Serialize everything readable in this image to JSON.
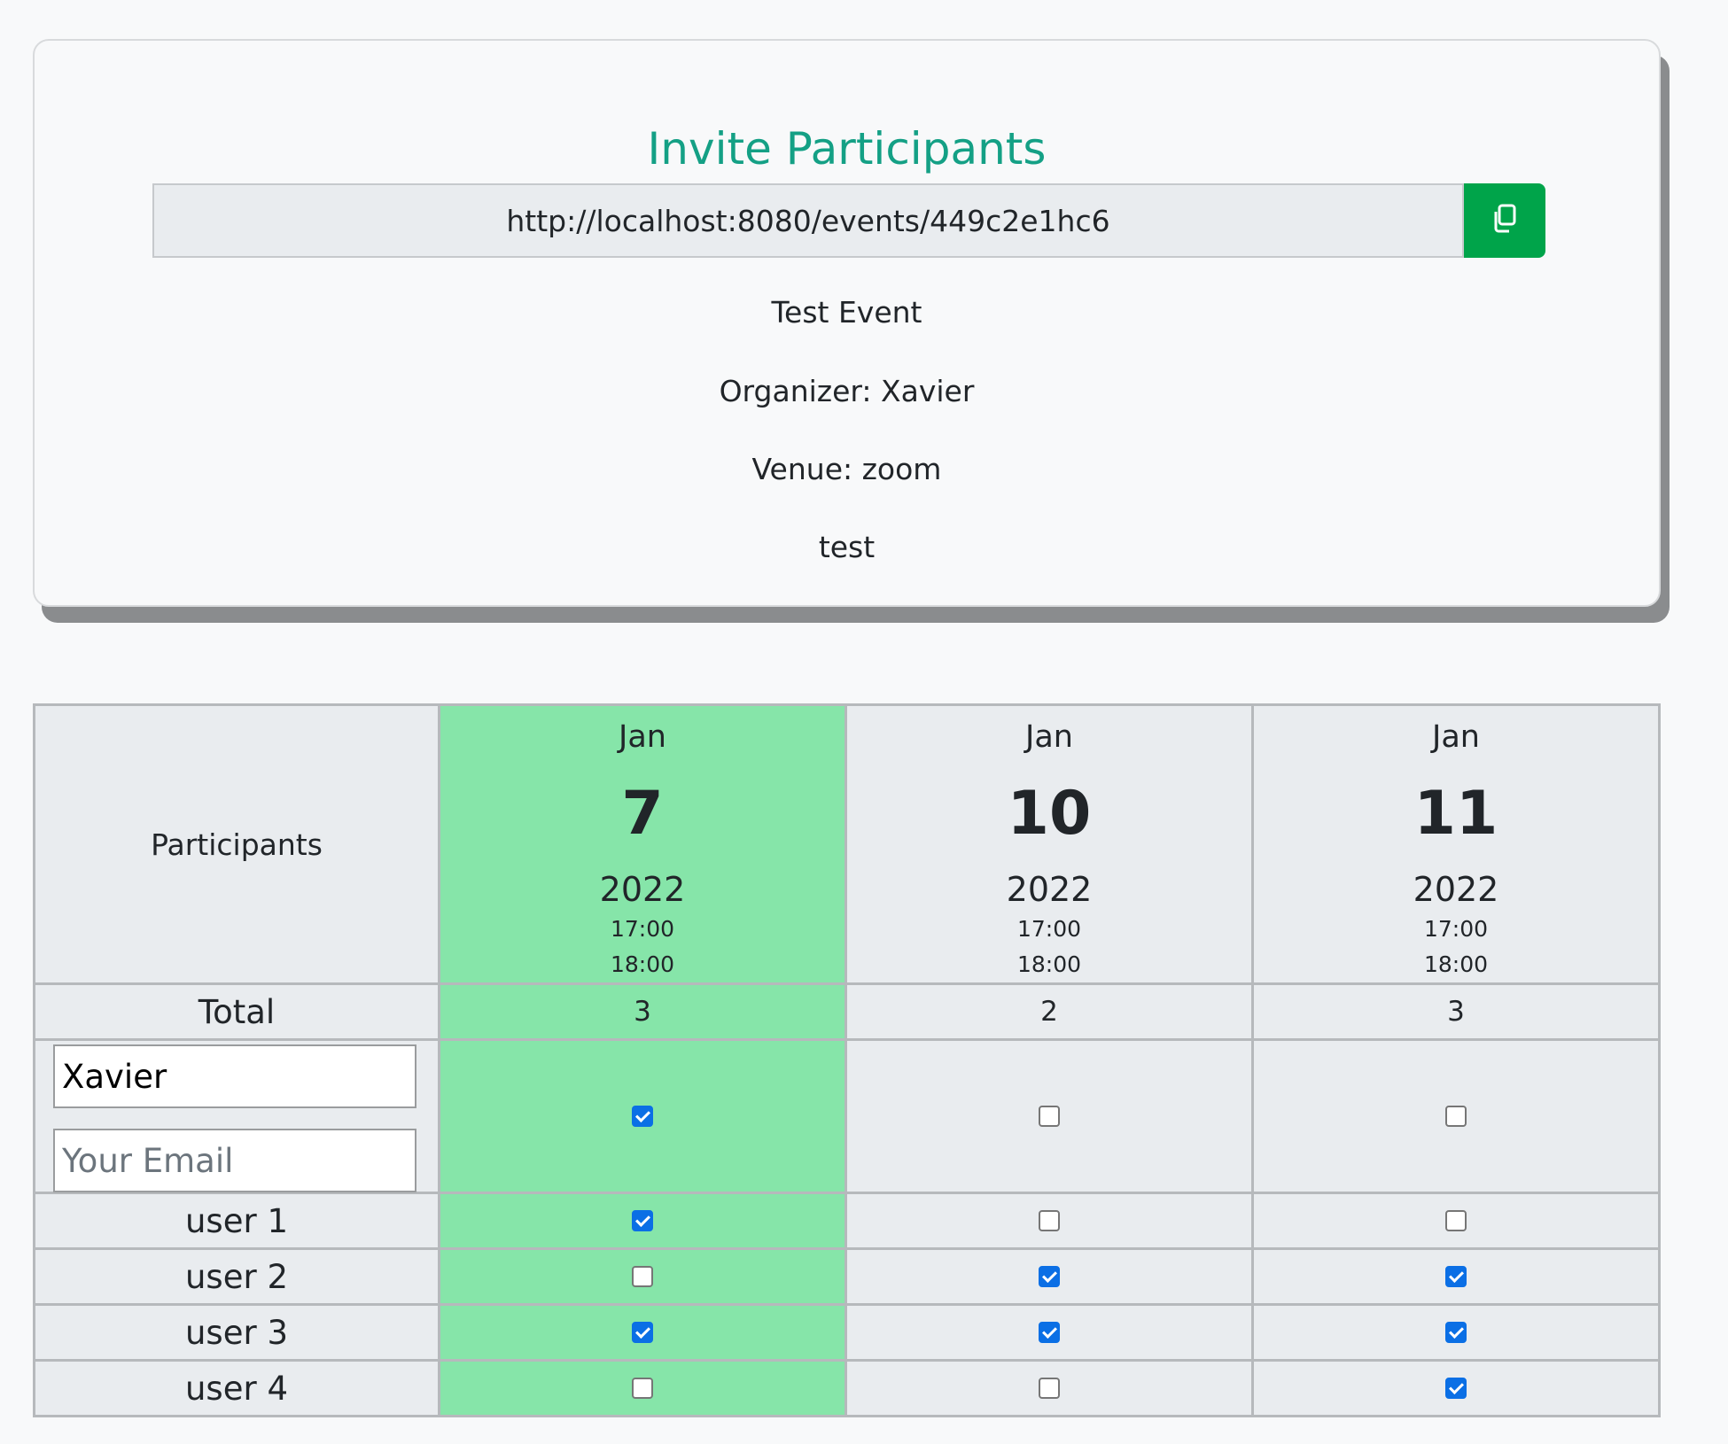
{
  "invite": {
    "title": "Invite Participants",
    "link": "http://localhost:8080/events/449c2e1hc6",
    "copy_icon": "copy-icon",
    "event_name": "Test Event",
    "organizer": "Organizer: Xavier",
    "venue": "Venue: zoom",
    "description": "test"
  },
  "table": {
    "participants_header": "Participants",
    "dates": [
      {
        "month": "Jan",
        "day": "7",
        "year": "2022",
        "start": "17:00",
        "end": "18:00",
        "best": true
      },
      {
        "month": "Jan",
        "day": "10",
        "year": "2022",
        "start": "17:00",
        "end": "18:00",
        "best": false
      },
      {
        "month": "Jan",
        "day": "11",
        "year": "2022",
        "start": "17:00",
        "end": "18:00",
        "best": false
      }
    ],
    "total_label": "Total",
    "totals": [
      "3",
      "2",
      "3"
    ],
    "me": {
      "name_value": "Xavier",
      "email_placeholder": "Your Email",
      "checks": [
        true,
        false,
        false
      ]
    },
    "users": [
      {
        "name": "user 1",
        "checks": [
          true,
          false,
          false
        ]
      },
      {
        "name": "user 2",
        "checks": [
          false,
          true,
          true
        ]
      },
      {
        "name": "user 3",
        "checks": [
          true,
          true,
          true
        ]
      },
      {
        "name": "user 4",
        "checks": [
          false,
          false,
          true
        ]
      }
    ],
    "best_color": "#86e5a9",
    "check_color": "#0b6fe5"
  },
  "colors": {
    "accent": "#14a085",
    "copy_button": "#00a44a",
    "background": "#f8f9fa",
    "cell": "#e9ecef"
  }
}
